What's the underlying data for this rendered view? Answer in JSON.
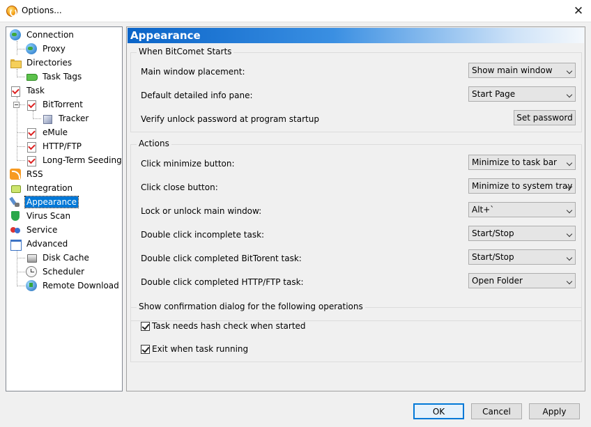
{
  "window": {
    "title": "Options...",
    "close_glyph": "✕"
  },
  "tree": {
    "items": [
      {
        "label": "Connection",
        "icon": "globe-icon"
      },
      {
        "label": "Proxy",
        "icon": "globe-icon"
      },
      {
        "label": "Directories",
        "icon": "folder-icon"
      },
      {
        "label": "Task Tags",
        "icon": "tag-icon"
      },
      {
        "label": "Task",
        "icon": "task-icon"
      },
      {
        "label": "BitTorrent",
        "icon": "task-icon"
      },
      {
        "label": "Tracker",
        "icon": "cube-icon"
      },
      {
        "label": "eMule",
        "icon": "task-icon"
      },
      {
        "label": "HTTP/FTP",
        "icon": "task-icon"
      },
      {
        "label": "Long-Term Seeding",
        "icon": "task-icon"
      },
      {
        "label": "RSS",
        "icon": "rss-icon"
      },
      {
        "label": "Integration",
        "icon": "plug-icon"
      },
      {
        "label": "Appearance",
        "icon": "brush-icon",
        "selected": true
      },
      {
        "label": "Virus Scan",
        "icon": "shield-icon"
      },
      {
        "label": "Service",
        "icon": "service-icon"
      },
      {
        "label": "Advanced",
        "icon": "advanced-icon"
      },
      {
        "label": "Disk Cache",
        "icon": "disk-icon"
      },
      {
        "label": "Scheduler",
        "icon": "clock-icon"
      },
      {
        "label": "Remote Download",
        "icon": "globe-icon"
      }
    ]
  },
  "panel": {
    "title": "Appearance",
    "startup": {
      "title": "When BitComet Starts",
      "placement_label": "Main window placement:",
      "placement_value": "Show main window",
      "info_pane_label": "Default detailed info pane:",
      "info_pane_value": "Start Page",
      "password_label": "Verify unlock password at program startup",
      "password_button": "Set password"
    },
    "actions": {
      "title": "Actions",
      "minimize_label": "Click minimize button:",
      "minimize_value": "Minimize to task bar",
      "close_label": "Click close button:",
      "close_value": "Minimize to system tray",
      "lock_label": "Lock or unlock main window:",
      "lock_value": "Alt+`",
      "incomplete_label": "Double click incomplete task:",
      "incomplete_value": "Start/Stop",
      "bt_label": "Double click completed BitTorent task:",
      "bt_value": "Start/Stop",
      "http_label": "Double click completed HTTP/FTP task:",
      "http_value": "Open Folder"
    },
    "confirm": {
      "title": "Show confirmation dialog for the following operations",
      "hash_label": "Task needs hash check when started",
      "hash_checked": true,
      "exit_label": "Exit when task running",
      "exit_checked": true
    }
  },
  "buttons": {
    "ok": "OK",
    "cancel": "Cancel",
    "apply": "Apply"
  }
}
